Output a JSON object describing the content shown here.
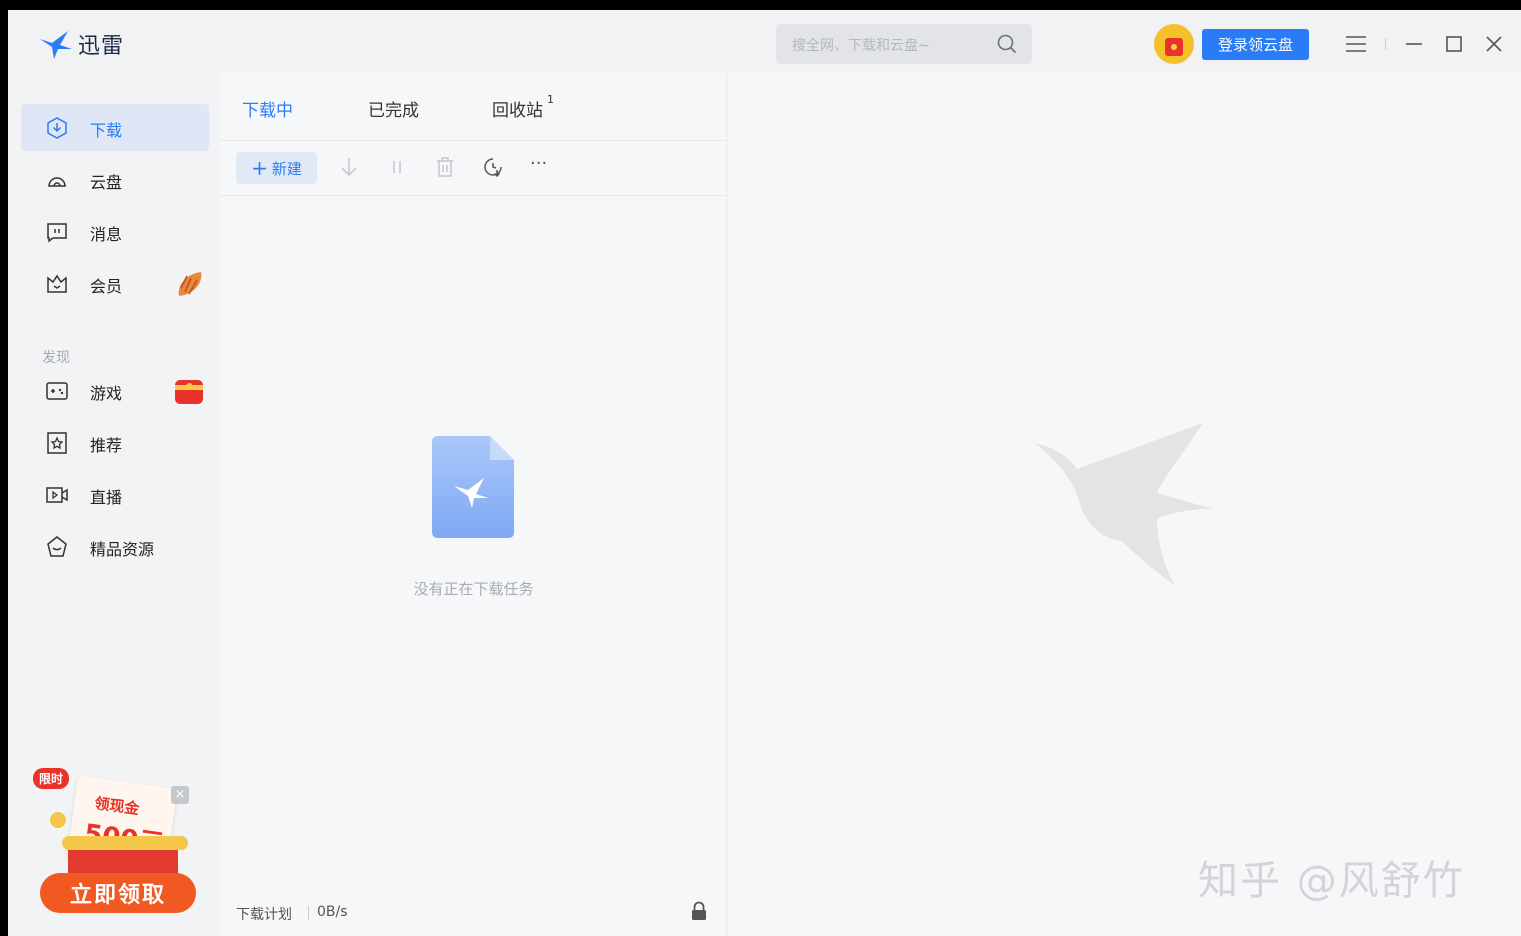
{
  "app": {
    "name": "迅雷"
  },
  "search": {
    "placeholder": "搜全网、下载和云盘~"
  },
  "header": {
    "login_label": "登录领云盘"
  },
  "sidebar": {
    "items": [
      {
        "label": "下载",
        "icon": "download-icon",
        "active": true
      },
      {
        "label": "云盘",
        "icon": "cloud-icon"
      },
      {
        "label": "消息",
        "icon": "message-icon"
      },
      {
        "label": "会员",
        "icon": "crown-icon"
      }
    ],
    "section_label": "发现",
    "discover": [
      {
        "label": "游戏",
        "icon": "gamepad-icon"
      },
      {
        "label": "推荐",
        "icon": "star-icon"
      },
      {
        "label": "直播",
        "icon": "video-icon"
      },
      {
        "label": "精品资源",
        "icon": "gem-icon"
      }
    ]
  },
  "promo": {
    "tag": "限时",
    "card_line1": "领现金",
    "card_line2": "500元",
    "button": "立即领取",
    "close": "×"
  },
  "tabs": [
    {
      "label": "下载中",
      "active": true
    },
    {
      "label": "已完成"
    },
    {
      "label": "回收站",
      "count": "1"
    }
  ],
  "toolbar": {
    "new_label": "新建",
    "plus": "+",
    "more": "···"
  },
  "empty": {
    "text": "没有正在下载任务"
  },
  "footer": {
    "plan": "下载计划",
    "speed": "0B/s"
  },
  "watermark": "知乎 @风舒竹",
  "colors": {
    "accent": "#2a7cf6",
    "sidebar_active": "#dfe7f6",
    "promo_red": "#e8322a"
  }
}
